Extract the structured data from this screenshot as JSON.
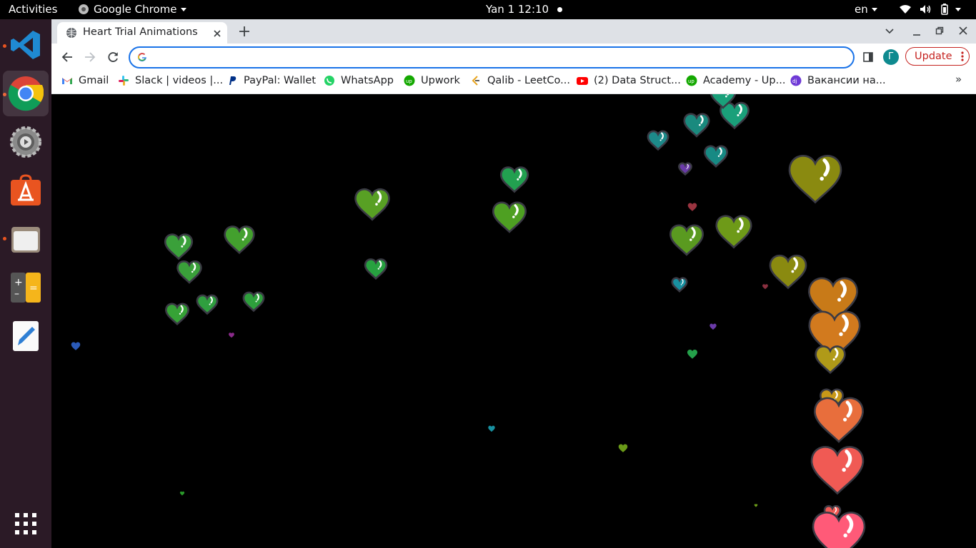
{
  "topbar": {
    "activities": "Activities",
    "app_name": "Google Chrome",
    "clock": "Yan 1  12:10",
    "lang": "en"
  },
  "dock": {
    "apps": [
      "vscode-icon",
      "chrome-icon",
      "settings-icon",
      "software-center-icon",
      "files-icon",
      "calculator-icon",
      "text-editor-icon"
    ],
    "show_apps_icon": "grid-icon"
  },
  "browser": {
    "tab_title": "Heart Trial Animations",
    "omnibox_value": "",
    "profile_letter": "Г",
    "update_label": "Update",
    "bookmarks": [
      {
        "label": "Gmail",
        "icon": "gmail-icon"
      },
      {
        "label": "Slack | videos |...",
        "icon": "slack-icon"
      },
      {
        "label": "PayPal: Wallet",
        "icon": "paypal-icon"
      },
      {
        "label": "WhatsApp",
        "icon": "whatsapp-icon"
      },
      {
        "label": "Upwork",
        "icon": "upwork-icon"
      },
      {
        "label": "Qalib - LeetCo...",
        "icon": "leetcode-icon"
      },
      {
        "label": "(2) Data Struct...",
        "icon": "youtube-icon"
      },
      {
        "label": "Academy - Up...",
        "icon": "upwork-icon"
      },
      {
        "label": "Вакансии на...",
        "icon": "djinni-icon"
      }
    ],
    "more_bookmarks": "»"
  },
  "colors": {
    "accent_blue": "#1a73e8",
    "update_red": "#c5221f",
    "dock_bg": "#2b1a26"
  }
}
